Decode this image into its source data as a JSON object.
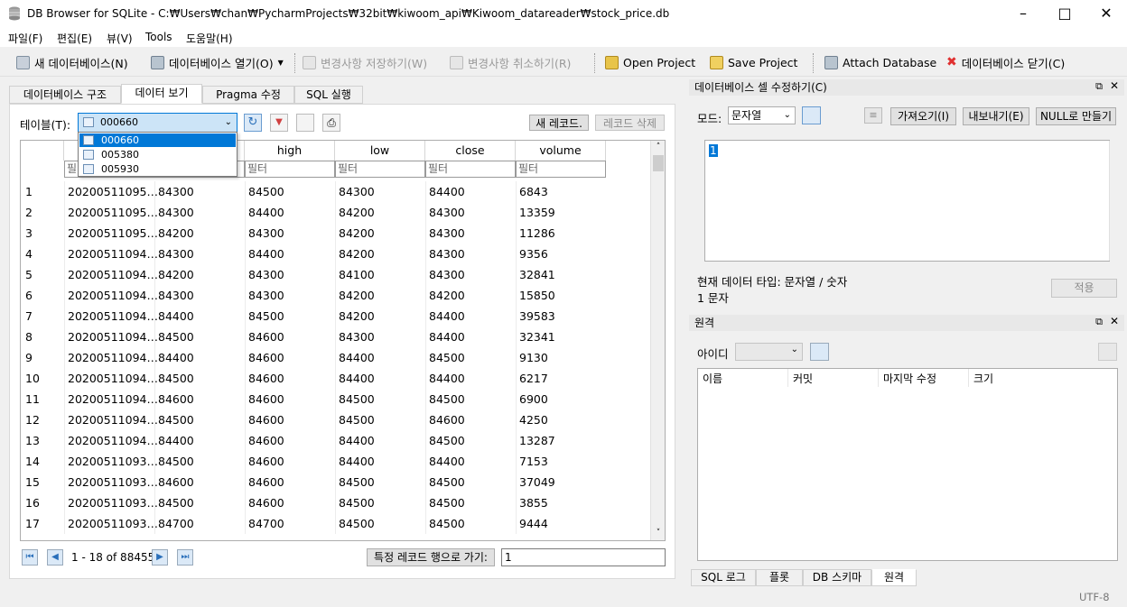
{
  "window": {
    "title": "DB Browser for SQLite - C:₩Users₩chan₩PycharmProjects₩32bit₩kiwoom_api₩Kiwoom_datareader₩stock_price.db"
  },
  "menu": [
    "파일(F)",
    "편집(E)",
    "뷰(V)",
    "Tools",
    "도움말(H)"
  ],
  "toolbar": {
    "new_db": "새 데이터베이스(N)",
    "open_db": "데이터베이스 열기(O)",
    "write_changes": "변경사항 저장하기(W)",
    "revert_changes": "변경사항 취소하기(R)",
    "open_project": "Open Project",
    "save_project": "Save Project",
    "attach_db": "Attach Database",
    "close_db": "데이터베이스 닫기(C)"
  },
  "main_tabs": [
    "데이터베이스 구조",
    "데이터 보기",
    "Pragma 수정",
    "SQL 실행"
  ],
  "browse": {
    "table_label": "테이블(T):",
    "table_selected": "000660",
    "table_options": [
      "000660",
      "005380",
      "005930"
    ],
    "new_record": "새 레코드.",
    "delete_record": "레코드 삭제",
    "columns": [
      "",
      "high",
      "low",
      "close",
      "volume"
    ],
    "filter_placeholder": "필터",
    "first_filter": "필",
    "rows": [
      [
        "1",
        "20200511095…",
        "84300",
        "84500",
        "84300",
        "84400",
        "6843"
      ],
      [
        "2",
        "20200511095…",
        "84300",
        "84400",
        "84200",
        "84300",
        "13359"
      ],
      [
        "3",
        "20200511095…",
        "84200",
        "84300",
        "84200",
        "84300",
        "11286"
      ],
      [
        "4",
        "20200511094…",
        "84300",
        "84400",
        "84200",
        "84300",
        "9356"
      ],
      [
        "5",
        "20200511094…",
        "84200",
        "84300",
        "84100",
        "84300",
        "32841"
      ],
      [
        "6",
        "20200511094…",
        "84300",
        "84300",
        "84200",
        "84200",
        "15850"
      ],
      [
        "7",
        "20200511094…",
        "84400",
        "84500",
        "84200",
        "84400",
        "39583"
      ],
      [
        "8",
        "20200511094…",
        "84500",
        "84600",
        "84300",
        "84400",
        "32341"
      ],
      [
        "9",
        "20200511094…",
        "84400",
        "84600",
        "84400",
        "84500",
        "9130"
      ],
      [
        "10",
        "20200511094…",
        "84500",
        "84600",
        "84400",
        "84400",
        "6217"
      ],
      [
        "11",
        "20200511094…",
        "84600",
        "84600",
        "84500",
        "84500",
        "6900"
      ],
      [
        "12",
        "20200511094…",
        "84500",
        "84600",
        "84500",
        "84600",
        "4250"
      ],
      [
        "13",
        "20200511094…",
        "84400",
        "84600",
        "84400",
        "84500",
        "13287"
      ],
      [
        "14",
        "20200511093…",
        "84500",
        "84600",
        "84400",
        "84400",
        "7153"
      ],
      [
        "15",
        "20200511093…",
        "84600",
        "84600",
        "84500",
        "84500",
        "37049"
      ],
      [
        "16",
        "20200511093…",
        "84500",
        "84600",
        "84500",
        "84500",
        "3855"
      ],
      [
        "17",
        "20200511093…",
        "84700",
        "84700",
        "84500",
        "84500",
        "9444"
      ]
    ],
    "record_count": "1 - 18 of 88455",
    "goto_label": "특정 레코드 행으로 가기:",
    "goto_value": "1"
  },
  "edit_cell": {
    "title": "데이터베이스 셀 수정하기(C)",
    "mode_label": "모드:",
    "mode_value": "문자열",
    "import": "가져오기(I)",
    "export": "내보내기(E)",
    "set_null": "NULL로 만들기",
    "content": "1",
    "type_info": "현재 데이터 타입: 문자열 / 숫자",
    "size_info": "1 문자",
    "apply": "적용"
  },
  "remote": {
    "title": "원격",
    "id_label": "아이디",
    "columns": [
      "이름",
      "커밋",
      "마지막 수정",
      "크기"
    ]
  },
  "bottom_tabs": [
    "SQL 로그",
    "플롯",
    "DB 스키마",
    "원격"
  ],
  "status": {
    "encoding": "UTF-8"
  }
}
